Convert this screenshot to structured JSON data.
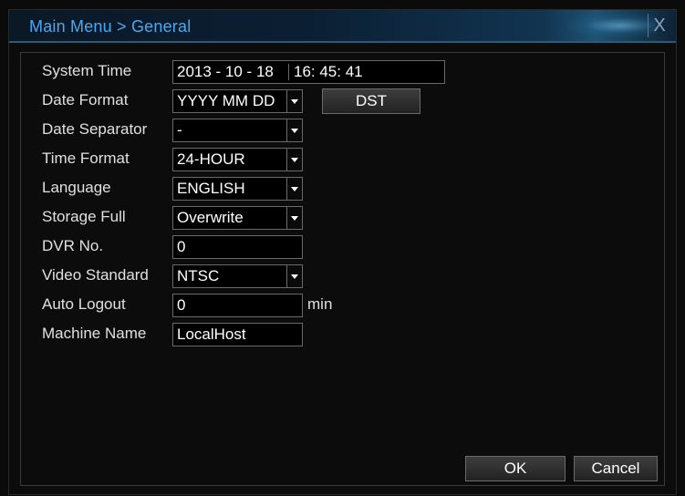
{
  "window": {
    "title": "Main Menu > General",
    "close_glyph": "X"
  },
  "form": {
    "system_time": {
      "label": "System Time",
      "date": "2013 - 10 - 18",
      "time": "16: 45: 41"
    },
    "date_format": {
      "label": "Date Format",
      "value": "YYYY MM DD",
      "dst_button": "DST"
    },
    "date_separator": {
      "label": "Date Separator",
      "value": "-"
    },
    "time_format": {
      "label": "Time Format",
      "value": "24-HOUR"
    },
    "language": {
      "label": "Language",
      "value": "ENGLISH"
    },
    "storage_full": {
      "label": "Storage Full",
      "value": "Overwrite"
    },
    "dvr_no": {
      "label": "DVR No.",
      "value": "0"
    },
    "video_standard": {
      "label": "Video Standard",
      "value": "NTSC"
    },
    "auto_logout": {
      "label": "Auto Logout",
      "value": "0",
      "unit": "min"
    },
    "machine_name": {
      "label": "Machine Name",
      "value": "LocalHost"
    }
  },
  "footer": {
    "ok_label": "OK",
    "cancel_label": "Cancel"
  },
  "icons": {
    "close": "close-icon",
    "dropdown": "chevron-down-icon"
  },
  "colors": {
    "title_text": "#4aa8f0",
    "background": "#0c0c0c",
    "field_border": "#6a6a6a",
    "text": "#e0e0e0"
  }
}
